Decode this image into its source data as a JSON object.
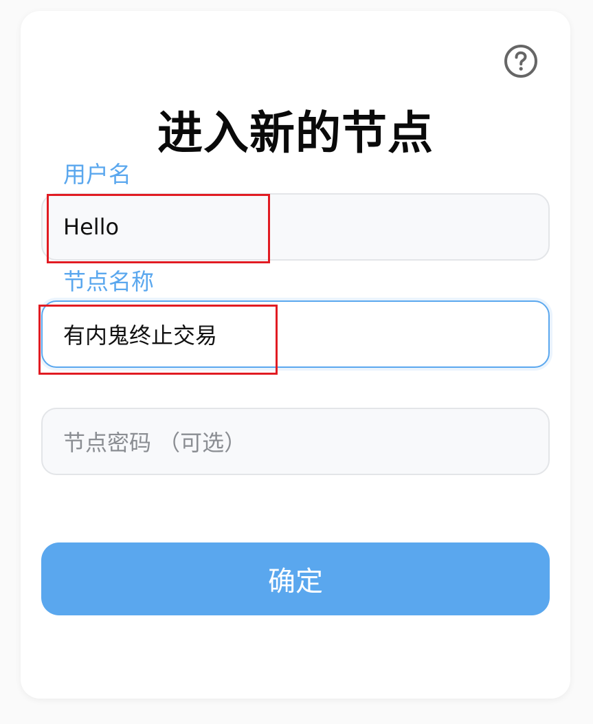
{
  "title": "进入新的节点",
  "help": {
    "icon": "help-circle-icon"
  },
  "username": {
    "label": "用户名",
    "value": "Hello"
  },
  "node_name": {
    "label": "节点名称",
    "value": "有内鬼终止交易"
  },
  "node_password": {
    "placeholder": "节点密码 （可选）",
    "value": ""
  },
  "confirm_label": "确定",
  "colors": {
    "accent": "#5aa7ee",
    "highlight": "#e11b22",
    "input_bg": "#f8f9fb",
    "input_border": "#e3e5e8"
  }
}
